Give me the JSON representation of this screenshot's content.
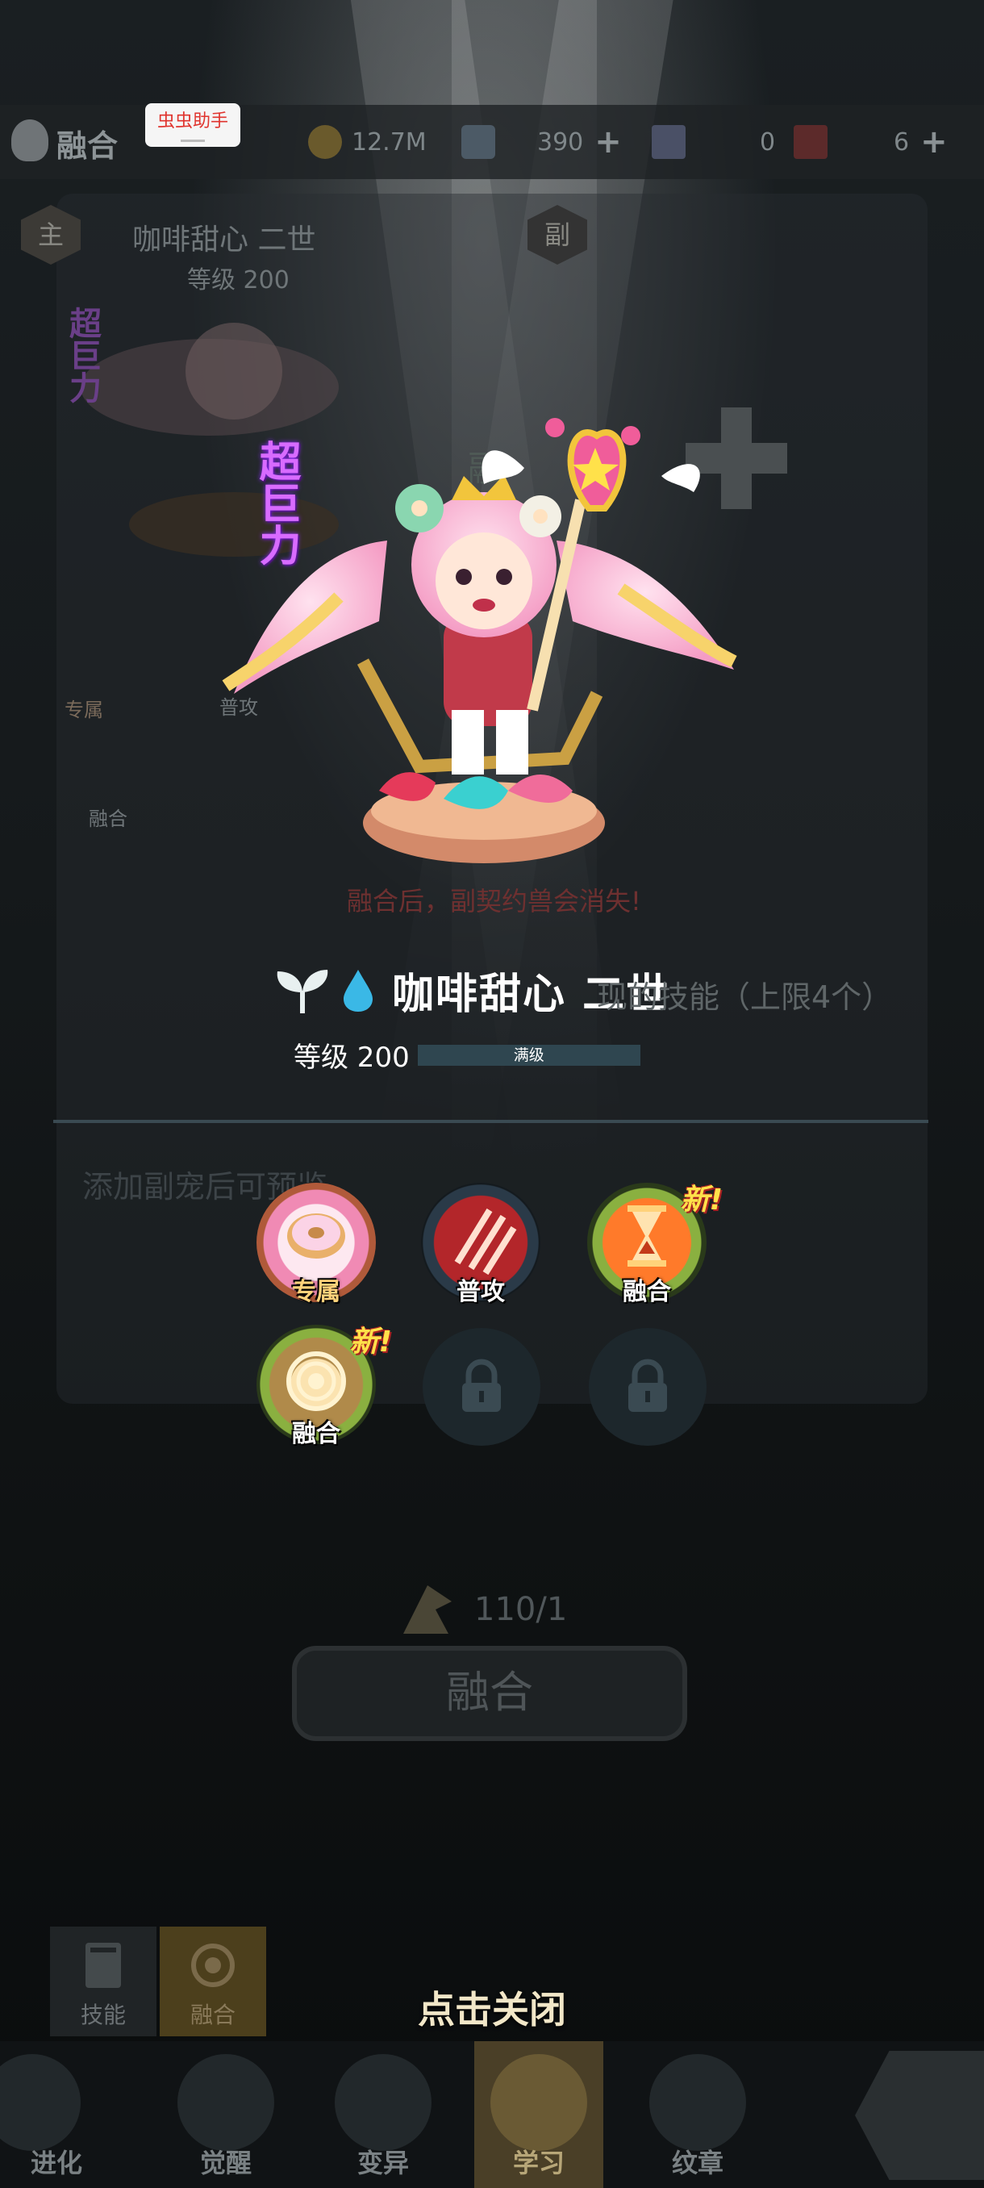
{
  "topbar": {
    "title": "融合",
    "helper_label": "虫虫助手",
    "resources": [
      {
        "value": "12.7M",
        "has_plus": false
      },
      {
        "value": "390",
        "has_plus": true
      },
      {
        "value": "0",
        "has_plus": false
      },
      {
        "value": "6",
        "has_plus": true
      }
    ]
  },
  "background_panel": {
    "main_badge": "主",
    "sub_badge": "副",
    "pet_name": "咖啡甜心 二世",
    "pet_level": "等级 200",
    "skill_labels": [
      "专属",
      "普攻",
      "融合"
    ],
    "warning": "融合后，副契约兽会消失!",
    "partial_text": "现的技能（上限4个）",
    "partial_label": "融"
  },
  "character": {
    "title_badge": "超巨力",
    "name": "咖啡甜心 二世",
    "level_text": "等级 200",
    "level_bar_label": "满级",
    "level_progress": 1.0
  },
  "hint": "添加副宠后可预览",
  "skills": [
    {
      "label": "专属",
      "is_new": false,
      "icon": "donut-icon"
    },
    {
      "label": "普攻",
      "is_new": false,
      "icon": "claw-icon"
    },
    {
      "label": "融合",
      "is_new": true,
      "icon": "hourglass-icon"
    },
    {
      "label": "融合",
      "is_new": true,
      "icon": "swirl-icon"
    },
    {
      "label": "",
      "is_new": false,
      "icon": "lock-icon"
    },
    {
      "label": "",
      "is_new": false,
      "icon": "lock-icon"
    }
  ],
  "new_tag": "新!",
  "cost": "110/1",
  "fuse_button": "融合",
  "subtabs": [
    "技能",
    "融合"
  ],
  "close_hint": "点击关闭",
  "bottom_nav": [
    "进化",
    "觉醒",
    "变异",
    "学习",
    "纹章"
  ],
  "colors": {
    "accent_gold": "#f2e7c8",
    "new_tag": "#ffe14a",
    "warning_red": "#6e3030"
  }
}
